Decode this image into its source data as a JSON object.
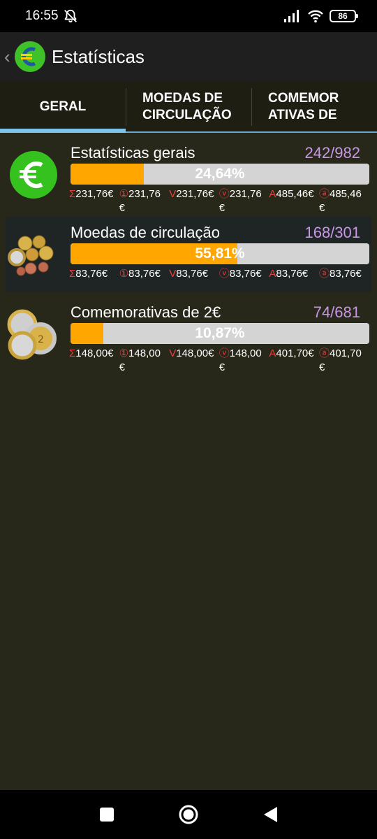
{
  "status": {
    "time": "16:55",
    "battery": "86"
  },
  "app": {
    "title": "Estatísticas"
  },
  "tabs": [
    {
      "label": "GERAL",
      "active": true
    },
    {
      "label": "MOEDAS DE\nCIRCULAÇÃO",
      "active": false
    },
    {
      "label": "COMEMOR\nATIVAS DE",
      "active": false
    }
  ],
  "rows": [
    {
      "name": "Estatísticas gerais",
      "count": "242/982",
      "percent_text": "24,64%",
      "progress": 0.2464,
      "values": [
        {
          "sym": "Σ",
          "val": "231,76€"
        },
        {
          "sym": "①",
          "val": "231,76 €"
        },
        {
          "sym": "V",
          "val": "231,76€"
        },
        {
          "sym": "ⓥ",
          "val": "231,76 €"
        },
        {
          "sym": "A",
          "val": "485,46€"
        },
        {
          "sym": "ⓐ",
          "val": "485,46 €"
        }
      ]
    },
    {
      "name": "Moedas de circulação",
      "count": "168/301",
      "percent_text": "55,81%",
      "progress": 0.5581,
      "values": [
        {
          "sym": "Σ",
          "val": "83,76€"
        },
        {
          "sym": "①",
          "val": "83,76€"
        },
        {
          "sym": "V",
          "val": "83,76€"
        },
        {
          "sym": "ⓥ",
          "val": "83,76€"
        },
        {
          "sym": "A",
          "val": "83,76€"
        },
        {
          "sym": "ⓐ",
          "val": "83,76€"
        }
      ]
    },
    {
      "name": "Comemorativas de 2€",
      "count": "74/681",
      "percent_text": "10,87%",
      "progress": 0.1087,
      "values": [
        {
          "sym": "Σ",
          "val": "148,00€"
        },
        {
          "sym": "①",
          "val": "148,00 €"
        },
        {
          "sym": "V",
          "val": "148,00€"
        },
        {
          "sym": "ⓥ",
          "val": "148,00 €"
        },
        {
          "sym": "A",
          "val": "401,70€"
        },
        {
          "sym": "ⓐ",
          "val": "401,70 €"
        }
      ]
    }
  ],
  "colors": {
    "accent": "#ffa600",
    "count": "#c896e6",
    "tab_indicator": "#7ec3ea",
    "symbol": "#e84040"
  },
  "icons": {
    "row_0": "euro-circle-icon",
    "row_1": "circulation-coins-icon",
    "row_2": "commemorative-coins-icon"
  }
}
